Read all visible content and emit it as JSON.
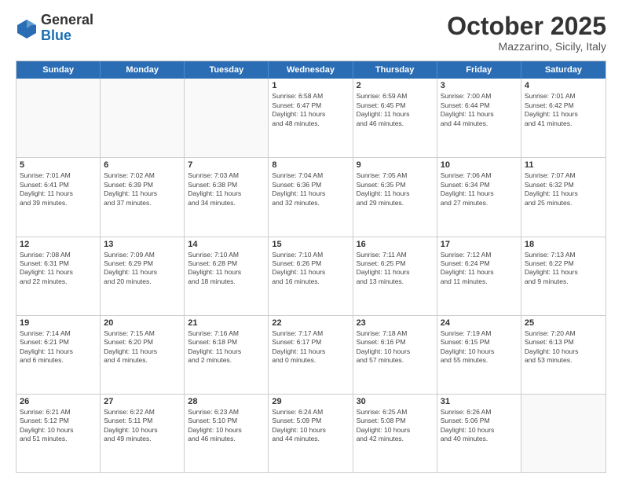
{
  "header": {
    "logo": {
      "general": "General",
      "blue": "Blue"
    },
    "title": "October 2025",
    "subtitle": "Mazzarino, Sicily, Italy"
  },
  "weekdays": [
    "Sunday",
    "Monday",
    "Tuesday",
    "Wednesday",
    "Thursday",
    "Friday",
    "Saturday"
  ],
  "weeks": [
    [
      {
        "day": "",
        "info": ""
      },
      {
        "day": "",
        "info": ""
      },
      {
        "day": "",
        "info": ""
      },
      {
        "day": "1",
        "info": "Sunrise: 6:58 AM\nSunset: 6:47 PM\nDaylight: 11 hours\nand 48 minutes."
      },
      {
        "day": "2",
        "info": "Sunrise: 6:59 AM\nSunset: 6:45 PM\nDaylight: 11 hours\nand 46 minutes."
      },
      {
        "day": "3",
        "info": "Sunrise: 7:00 AM\nSunset: 6:44 PM\nDaylight: 11 hours\nand 44 minutes."
      },
      {
        "day": "4",
        "info": "Sunrise: 7:01 AM\nSunset: 6:42 PM\nDaylight: 11 hours\nand 41 minutes."
      }
    ],
    [
      {
        "day": "5",
        "info": "Sunrise: 7:01 AM\nSunset: 6:41 PM\nDaylight: 11 hours\nand 39 minutes."
      },
      {
        "day": "6",
        "info": "Sunrise: 7:02 AM\nSunset: 6:39 PM\nDaylight: 11 hours\nand 37 minutes."
      },
      {
        "day": "7",
        "info": "Sunrise: 7:03 AM\nSunset: 6:38 PM\nDaylight: 11 hours\nand 34 minutes."
      },
      {
        "day": "8",
        "info": "Sunrise: 7:04 AM\nSunset: 6:36 PM\nDaylight: 11 hours\nand 32 minutes."
      },
      {
        "day": "9",
        "info": "Sunrise: 7:05 AM\nSunset: 6:35 PM\nDaylight: 11 hours\nand 29 minutes."
      },
      {
        "day": "10",
        "info": "Sunrise: 7:06 AM\nSunset: 6:34 PM\nDaylight: 11 hours\nand 27 minutes."
      },
      {
        "day": "11",
        "info": "Sunrise: 7:07 AM\nSunset: 6:32 PM\nDaylight: 11 hours\nand 25 minutes."
      }
    ],
    [
      {
        "day": "12",
        "info": "Sunrise: 7:08 AM\nSunset: 6:31 PM\nDaylight: 11 hours\nand 22 minutes."
      },
      {
        "day": "13",
        "info": "Sunrise: 7:09 AM\nSunset: 6:29 PM\nDaylight: 11 hours\nand 20 minutes."
      },
      {
        "day": "14",
        "info": "Sunrise: 7:10 AM\nSunset: 6:28 PM\nDaylight: 11 hours\nand 18 minutes."
      },
      {
        "day": "15",
        "info": "Sunrise: 7:10 AM\nSunset: 6:26 PM\nDaylight: 11 hours\nand 16 minutes."
      },
      {
        "day": "16",
        "info": "Sunrise: 7:11 AM\nSunset: 6:25 PM\nDaylight: 11 hours\nand 13 minutes."
      },
      {
        "day": "17",
        "info": "Sunrise: 7:12 AM\nSunset: 6:24 PM\nDaylight: 11 hours\nand 11 minutes."
      },
      {
        "day": "18",
        "info": "Sunrise: 7:13 AM\nSunset: 6:22 PM\nDaylight: 11 hours\nand 9 minutes."
      }
    ],
    [
      {
        "day": "19",
        "info": "Sunrise: 7:14 AM\nSunset: 6:21 PM\nDaylight: 11 hours\nand 6 minutes."
      },
      {
        "day": "20",
        "info": "Sunrise: 7:15 AM\nSunset: 6:20 PM\nDaylight: 11 hours\nand 4 minutes."
      },
      {
        "day": "21",
        "info": "Sunrise: 7:16 AM\nSunset: 6:18 PM\nDaylight: 11 hours\nand 2 minutes."
      },
      {
        "day": "22",
        "info": "Sunrise: 7:17 AM\nSunset: 6:17 PM\nDaylight: 11 hours\nand 0 minutes."
      },
      {
        "day": "23",
        "info": "Sunrise: 7:18 AM\nSunset: 6:16 PM\nDaylight: 10 hours\nand 57 minutes."
      },
      {
        "day": "24",
        "info": "Sunrise: 7:19 AM\nSunset: 6:15 PM\nDaylight: 10 hours\nand 55 minutes."
      },
      {
        "day": "25",
        "info": "Sunrise: 7:20 AM\nSunset: 6:13 PM\nDaylight: 10 hours\nand 53 minutes."
      }
    ],
    [
      {
        "day": "26",
        "info": "Sunrise: 6:21 AM\nSunset: 5:12 PM\nDaylight: 10 hours\nand 51 minutes."
      },
      {
        "day": "27",
        "info": "Sunrise: 6:22 AM\nSunset: 5:11 PM\nDaylight: 10 hours\nand 49 minutes."
      },
      {
        "day": "28",
        "info": "Sunrise: 6:23 AM\nSunset: 5:10 PM\nDaylight: 10 hours\nand 46 minutes."
      },
      {
        "day": "29",
        "info": "Sunrise: 6:24 AM\nSunset: 5:09 PM\nDaylight: 10 hours\nand 44 minutes."
      },
      {
        "day": "30",
        "info": "Sunrise: 6:25 AM\nSunset: 5:08 PM\nDaylight: 10 hours\nand 42 minutes."
      },
      {
        "day": "31",
        "info": "Sunrise: 6:26 AM\nSunset: 5:06 PM\nDaylight: 10 hours\nand 40 minutes."
      },
      {
        "day": "",
        "info": ""
      }
    ]
  ]
}
